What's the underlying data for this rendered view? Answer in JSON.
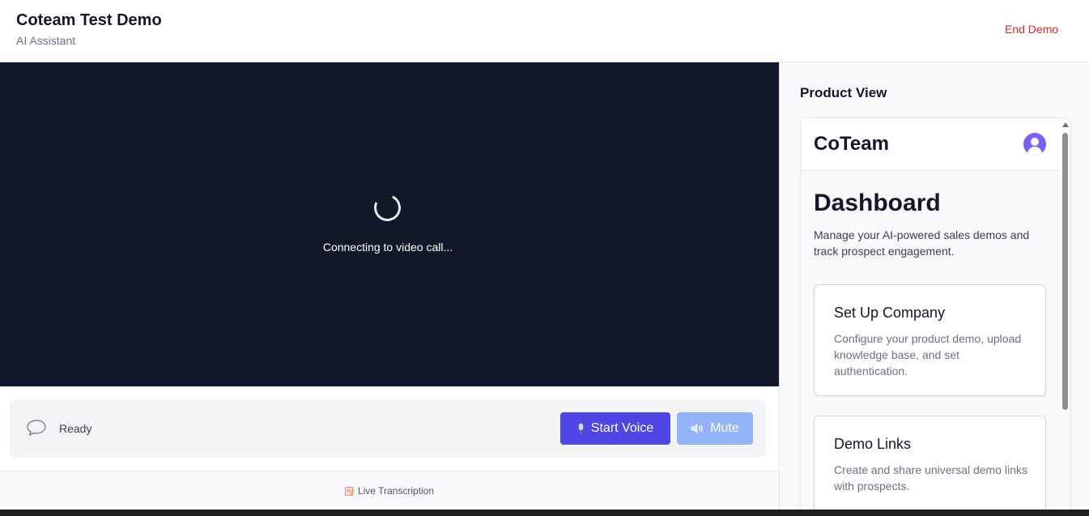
{
  "header": {
    "title": "Coteam Test Demo",
    "subtitle": "AI Assistant",
    "end_demo_label": "End Demo"
  },
  "video": {
    "status_text": "Connecting to video call..."
  },
  "controls": {
    "status": "Ready",
    "start_voice_label": "Start Voice",
    "mute_label": "Mute",
    "icons": {
      "status": "chat-bubble-icon",
      "start_voice": "microphone-icon",
      "mute": "speaker-icon"
    }
  },
  "transcription": {
    "label": "Live Transcription",
    "icon": "memo-icon"
  },
  "product_view": {
    "title": "Product View",
    "app": {
      "brand": "CoTeam",
      "dashboard_title": "Dashboard",
      "dashboard_description": "Manage your AI-powered sales demos and track prospect engagement.",
      "cards": [
        {
          "title": "Set Up Company",
          "description": "Configure your product demo, upload knowledge base, and set authentication."
        },
        {
          "title": "Demo Links",
          "description": "Create and share universal demo links with prospects."
        }
      ]
    }
  },
  "colors": {
    "primary": "#4f46e5",
    "mute_disabled": "#93b4f8",
    "danger": "#dc2626",
    "video_bg": "#111827"
  }
}
